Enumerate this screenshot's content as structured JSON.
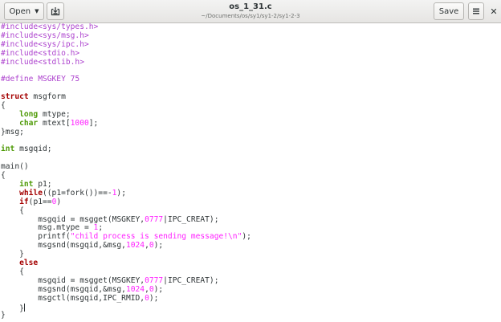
{
  "header": {
    "open_label": "Open",
    "title": "os_1_31.c",
    "path": "~/Documents/os/sy1/sy1-2/sy1-2-3",
    "save_label": "Save",
    "icons": {
      "open_caret": "caret-down-icon",
      "save_as": "document-save-icon",
      "menu": "hamburger-menu-icon",
      "close": "close-icon"
    }
  },
  "editor": {
    "syntax_colors": {
      "preprocessor": "#ad43ce",
      "keyword": "#a40000",
      "type": "#4e9a06",
      "number": "#ff1fff",
      "string": "#ff1fff",
      "text": "#2e3436"
    },
    "lines": [
      [
        {
          "t": "#include<sys/types.h>",
          "c": "pp"
        }
      ],
      [
        {
          "t": "#include<sys/msg.h>",
          "c": "pp"
        }
      ],
      [
        {
          "t": "#include<sys/ipc.h>",
          "c": "pp"
        }
      ],
      [
        {
          "t": "#include<stdio.h>",
          "c": "pp"
        }
      ],
      [
        {
          "t": "#include<stdlib.h>",
          "c": "pp"
        }
      ],
      [],
      [
        {
          "t": "#define MSGKEY 75",
          "c": "pp"
        }
      ],
      [],
      [
        {
          "t": "struct",
          "c": "kw"
        },
        {
          "t": " msgform"
        }
      ],
      [
        {
          "t": "{"
        }
      ],
      [
        {
          "t": "    "
        },
        {
          "t": "long",
          "c": "ty"
        },
        {
          "t": " mtype;"
        }
      ],
      [
        {
          "t": "    "
        },
        {
          "t": "char",
          "c": "ty"
        },
        {
          "t": " mtext["
        },
        {
          "t": "1000",
          "c": "num"
        },
        {
          "t": "];"
        }
      ],
      [
        {
          "t": "}msg;"
        }
      ],
      [],
      [
        {
          "t": "int",
          "c": "ty"
        },
        {
          "t": " msgqid;"
        }
      ],
      [],
      [
        {
          "t": "main()"
        }
      ],
      [
        {
          "t": "{"
        }
      ],
      [
        {
          "t": "    "
        },
        {
          "t": "int",
          "c": "ty"
        },
        {
          "t": " p1;"
        }
      ],
      [
        {
          "t": "    "
        },
        {
          "t": "while",
          "c": "kw"
        },
        {
          "t": "((p1=fork())==-"
        },
        {
          "t": "1",
          "c": "num"
        },
        {
          "t": ");"
        }
      ],
      [
        {
          "t": "    "
        },
        {
          "t": "if",
          "c": "kw"
        },
        {
          "t": "(p1=="
        },
        {
          "t": "0",
          "c": "num"
        },
        {
          "t": ")"
        }
      ],
      [
        {
          "t": "    {"
        }
      ],
      [
        {
          "t": "        msgqid = msgget(MSGKEY,"
        },
        {
          "t": "0777",
          "c": "num"
        },
        {
          "t": "|IPC_CREAT);"
        }
      ],
      [
        {
          "t": "        msg.mtype = "
        },
        {
          "t": "1",
          "c": "num"
        },
        {
          "t": ";"
        }
      ],
      [
        {
          "t": "        printf("
        },
        {
          "t": "\"child process is sending message!\\n\"",
          "c": "str"
        },
        {
          "t": ");"
        }
      ],
      [
        {
          "t": "        msgsnd(msgqid,&msg,"
        },
        {
          "t": "1024",
          "c": "num"
        },
        {
          "t": ","
        },
        {
          "t": "0",
          "c": "num"
        },
        {
          "t": ");"
        }
      ],
      [
        {
          "t": "    }"
        }
      ],
      [
        {
          "t": "    "
        },
        {
          "t": "else",
          "c": "kw"
        }
      ],
      [
        {
          "t": "    {"
        }
      ],
      [
        {
          "t": "        msgqid = msgget(MSGKEY,"
        },
        {
          "t": "0777",
          "c": "num"
        },
        {
          "t": "|IPC_CREAT);"
        }
      ],
      [
        {
          "t": "        msgsnd(msgqid,&msg,"
        },
        {
          "t": "1024",
          "c": "num"
        },
        {
          "t": ","
        },
        {
          "t": "0",
          "c": "num"
        },
        {
          "t": ");"
        }
      ],
      [
        {
          "t": "        msgctl(msgqid,IPC_RMID,"
        },
        {
          "t": "0",
          "c": "num"
        },
        {
          "t": ");"
        }
      ],
      [
        {
          "t": "    }"
        },
        {
          "cursor": true
        }
      ],
      [
        {
          "t": "}"
        }
      ]
    ]
  }
}
